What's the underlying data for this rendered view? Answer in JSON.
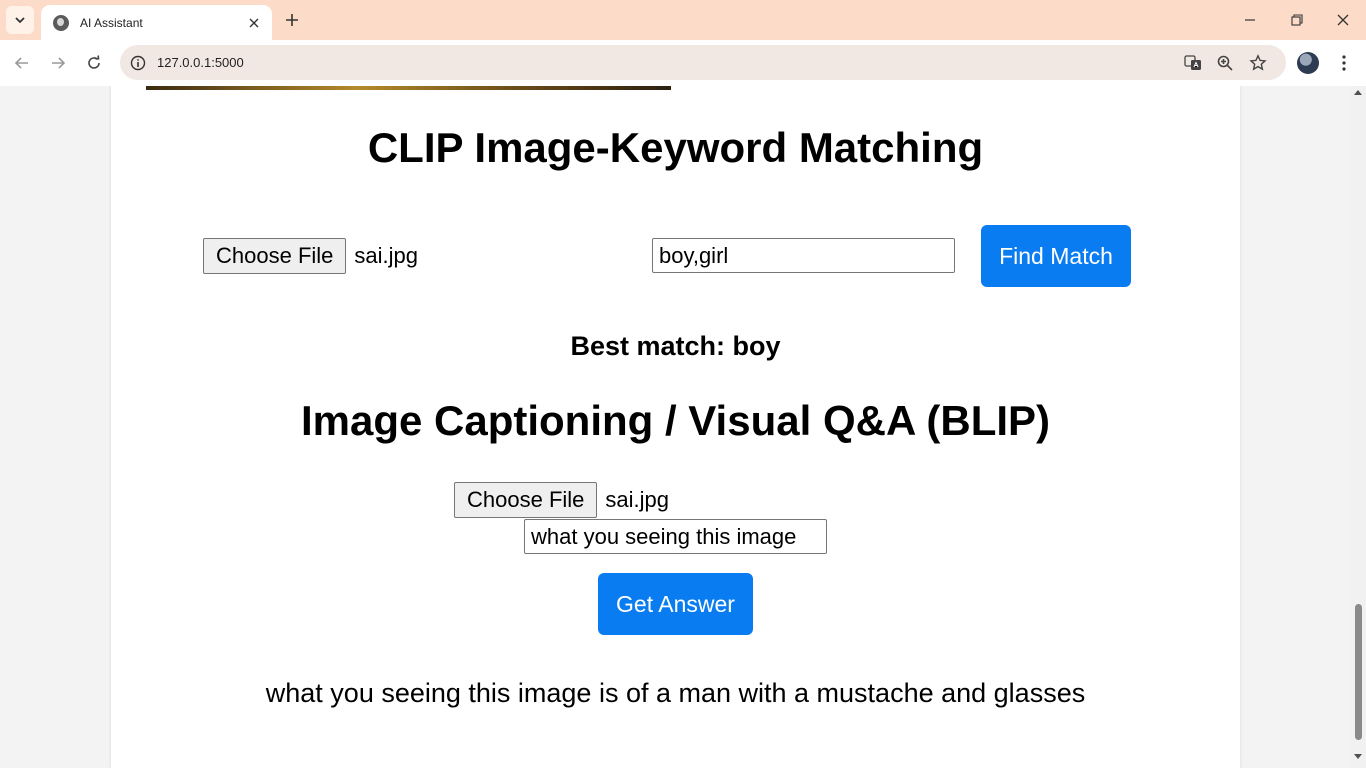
{
  "browser": {
    "tab_title": "AI Assistant",
    "url": "127.0.0.1:5000"
  },
  "clip": {
    "title": "CLIP Image-Keyword Matching",
    "file_button_label": "Choose File",
    "file_name": "sai.jpg",
    "keywords_value": "boy,girl",
    "submit_label": "Find Match",
    "result": "Best match: boy"
  },
  "blip": {
    "title": "Image Captioning / Visual Q&A (BLIP)",
    "file_button_label": "Choose File",
    "file_name": "sai.jpg",
    "question_value": "what you seeing this image",
    "submit_label": "Get Answer",
    "answer": "what you seeing this image is of a man with a mustache and glasses"
  },
  "colors": {
    "primary_button": "#0a7cf2",
    "tab_strip": "#fcdcc8"
  }
}
